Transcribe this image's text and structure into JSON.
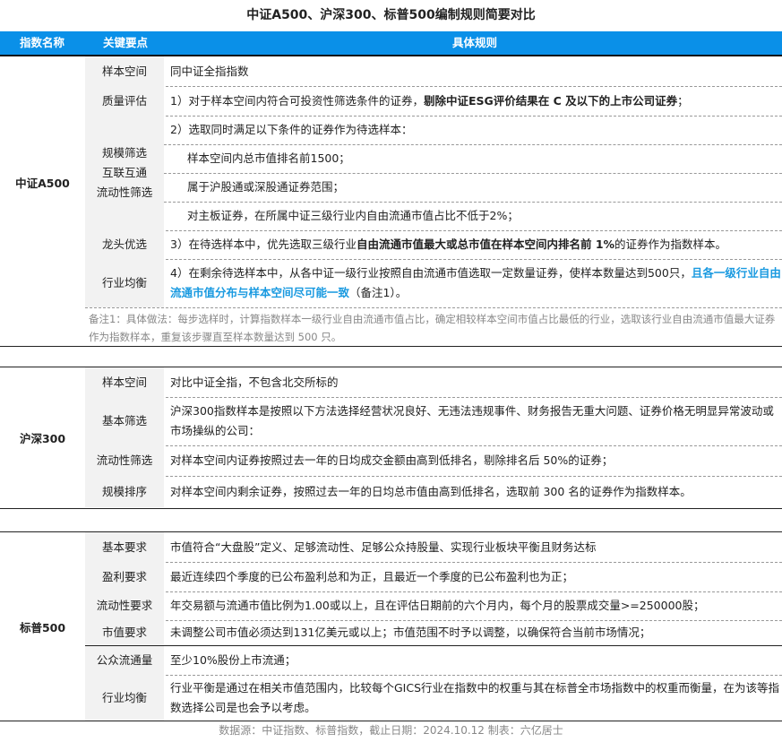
{
  "title": "中证A500、沪深300、标普500编制规则简要对比",
  "header": {
    "col1": "指数名称",
    "col2": "关键要点",
    "col3": "具体规则"
  },
  "csi_a500": {
    "name": "中证A500",
    "rows": [
      {
        "key": "样本空间",
        "rule": "同中证全指指数"
      },
      {
        "key": "质量评估",
        "rule_plain": "1）对于样本空间内符合可投资性筛选条件的证券，",
        "rule_bold": "剔除中证ESG评价结果在 C 及以下的上市公司证券",
        "rule_end": "；"
      },
      {
        "key_lines": [
          "规模筛选",
          "互联互通",
          "流动性筛选"
        ],
        "sub": [
          "2）选取同时满足以下条件的证券作为待选样本：",
          "样本空间内总市值排名前1500；",
          "属于沪股通或深股通证券范围；",
          "对主板证券，在所属中证三级行业内自由流通市值占比不低于2%；"
        ]
      },
      {
        "key": "龙头优选",
        "rule_plain": "3）在待选样本中，优先选取三级行业",
        "rule_bold": "自由流通市值最大或总市值在样本空间内排名前 1%",
        "rule_end": "的证券作为指数样本。"
      },
      {
        "key": "行业均衡",
        "rule_plain": "4）在剩余待选样本中，从各中证一级行业按照自由流通市值选取一定数量证券，使样本数量达到500只，",
        "rule_blue": "且各一级行业自由流通市值分布与样本空间尽可能一致",
        "rule_end": "（备注1）。"
      }
    ],
    "note": "备注1：具体做法：每步选样时，计算指数样本一级行业自由流通市值占比，确定相较样本空间市值占比最低的行业，选取该行业自由流通市值最大证券作为指数样本，重复该步骤直至样本数量达到 500 只。"
  },
  "csi300": {
    "name": "沪深300",
    "rows": [
      {
        "key": "样本空间",
        "rule": "对比中证全指，不包含北交所标的"
      },
      {
        "key": "基本筛选",
        "rule": "沪深300指数样本是按照以下方法选择经营状况良好、无违法违规事件、财务报告无重大问题、证券价格无明显异常波动或市场操纵的公司："
      },
      {
        "key": "流动性筛选",
        "rule": "对样本空间内证券按照过去一年的日均成交金额由高到低排名，剔除排名后 50%的证券；"
      },
      {
        "key": "规模排序",
        "rule": "对样本空间内剩余证券，按照过去一年的日均总市值由高到低排名，选取前 300 名的证券作为指数样本。"
      }
    ]
  },
  "sp500": {
    "name": "标普500",
    "rows": [
      {
        "key": "基本要求",
        "rule": "市值符合“大盘股”定义、足够流动性、足够公众持股量、实现行业板块平衡且财务达标"
      },
      {
        "key": "盈利要求",
        "rule": "最近连续四个季度的已公布盈利总和为正，且最近一个季度的已公布盈利也为正；"
      },
      {
        "key": "流动性要求",
        "rule": "年交易额与流通市值比例为1.00或以上，且在评估日期前的六个月内，每个月的股票成交量>=250000股；"
      },
      {
        "key": "市值要求",
        "rule": "未调整公司市值必须达到131亿美元或以上；市值范围不时予以调整，以确保符合当前市场情况；"
      },
      {
        "key": "公众流通量",
        "rule": "至少10%股份上市流通；"
      },
      {
        "key": "行业均衡",
        "rule": "行业平衡是通过在相关市值范围内，比较每个GICS行业在指数中的权重与其在标普全市场指数中的权重而衡量，在为该等指数选择公司是也会予以考虑。"
      }
    ]
  },
  "footer": "数据源：中证指数、标普指数，截止日期：2024.10.12   制表：六亿居士"
}
